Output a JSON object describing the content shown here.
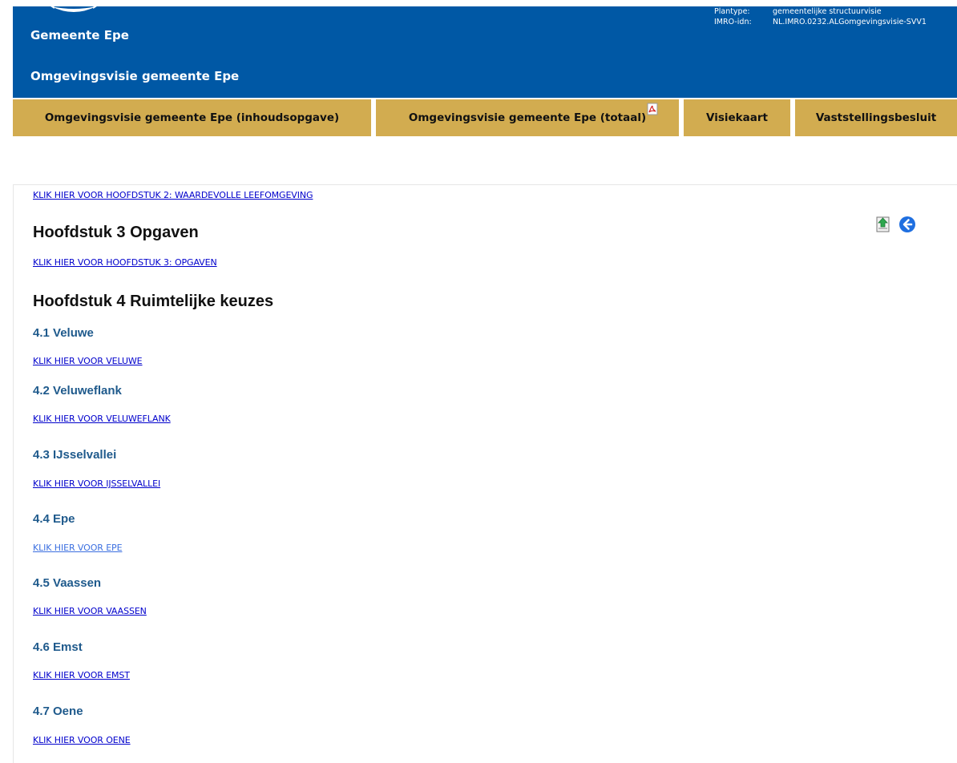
{
  "header": {
    "municipality": "Gemeente Epe",
    "plan_title": "Omgevingsvisie gemeente Epe",
    "meta": [
      {
        "key": "Plantype:",
        "value": "gemeentelijke structuurvisie"
      },
      {
        "key": "IMRO-idn:",
        "value": "NL.IMRO.0232.ALGomgevingsvisie-SVV1"
      }
    ],
    "brand_color": "#0058a5"
  },
  "nav": {
    "accent_color": "#d2ac50",
    "tabs": [
      {
        "label": "Omgevingsvisie gemeente Epe (inhoudsopgave)"
      },
      {
        "label": "Omgevingsvisie gemeente Epe (totaal)",
        "icon": "pdf-icon"
      },
      {
        "label": "Visiekaart"
      },
      {
        "label": "Vaststellingsbesluit"
      }
    ]
  },
  "toolbar": {
    "icons": [
      "document-up-icon",
      "back-arrow-icon"
    ]
  },
  "content": {
    "link_ch2": "KLIK HIER VOOR HOOFDSTUK 2: WAARDEVOLLE LEEFOMGEVING",
    "ch3_title": "Hoofdstuk 3 Opgaven",
    "link_ch3": "KLIK HIER VOOR HOOFDSTUK 3: OPGAVEN",
    "ch4_title": "Hoofdstuk 4 Ruimtelijke keuzes",
    "sections": [
      {
        "title": "4.1 Veluwe",
        "link": "KLIK HIER VOOR VELUWE"
      },
      {
        "title": "4.2 Veluweflank",
        "link": "KLIK HIER VOOR VELUWEFLANK"
      },
      {
        "title": "4.3 IJsselvallei",
        "link": "KLIK HIER VOOR IJSSELVALLEI"
      },
      {
        "title": "4.4 Epe",
        "link": "KLIK HIER VOOR EPE"
      },
      {
        "title": "4.5 Vaassen",
        "link": "KLIK HIER VOOR VAASSEN"
      },
      {
        "title": "4.6 Emst",
        "link": "KLIK HIER VOOR EMST"
      },
      {
        "title": "4.7 Oene",
        "link": "KLIK HIER VOOR OENE"
      }
    ]
  }
}
